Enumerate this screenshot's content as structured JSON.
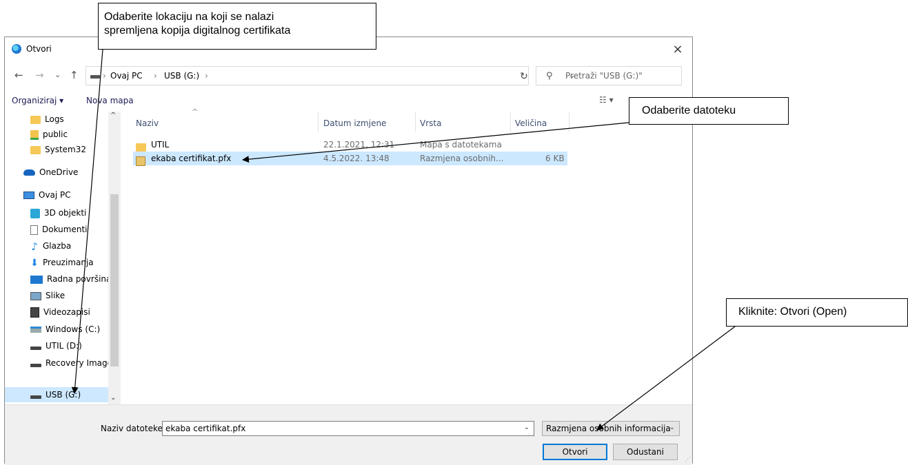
{
  "dialog": {
    "title": "Otvori",
    "close_glyph": "×",
    "nav": {
      "back": "←",
      "forward": "→",
      "recent": "⌄",
      "up": "↑"
    },
    "breadcrumb": [
      "Ovaj PC",
      "USB (G:)"
    ],
    "crumb_sep": "›",
    "refresh_glyph": "↻",
    "search_placeholder": "Pretraži \"USB (G:)\"",
    "toolbar": {
      "organize": "Organiziraj ▾",
      "new_folder": "Nova mapa"
    },
    "nav_items": [
      {
        "label": "Logs",
        "icon": "folder-icon"
      },
      {
        "label": "public",
        "icon": "public-folder-icon"
      },
      {
        "label": "System32",
        "icon": "folder-icon"
      },
      {
        "label": "OneDrive",
        "icon": "onedrive-icon"
      },
      {
        "label": "Ovaj PC",
        "icon": "pc-icon"
      },
      {
        "label": "3D objekti",
        "icon": "3d-objects-icon"
      },
      {
        "label": "Dokumenti",
        "icon": "documents-icon"
      },
      {
        "label": "Glazba",
        "icon": "music-icon"
      },
      {
        "label": "Preuzimanja",
        "icon": "downloads-icon"
      },
      {
        "label": "Radna površina",
        "icon": "desktop-icon"
      },
      {
        "label": "Slike",
        "icon": "pictures-icon"
      },
      {
        "label": "Videozapisi",
        "icon": "videos-icon"
      },
      {
        "label": "Windows (C:)",
        "icon": "windows-drive-icon"
      },
      {
        "label": "UTIL (D:)",
        "icon": "drive-icon"
      },
      {
        "label": "Recovery Image",
        "icon": "drive-icon"
      },
      {
        "label": "USB (G:)",
        "icon": "drive-icon"
      }
    ],
    "columns": {
      "name": "Naziv",
      "date": "Datum izmjene",
      "type": "Vrsta",
      "size": "Veličina"
    },
    "files": [
      {
        "name": "UTIL",
        "date": "22.1.2021. 12:31",
        "type": "Mapa s datotekama",
        "size": ""
      },
      {
        "name": "ekaba certifikat.pfx",
        "date": "4.5.2022. 13:48",
        "type": "Razmjena osobnih...",
        "size": "6 KB"
      }
    ],
    "filename_label": "Naziv datoteke:",
    "filename_value": "ekaba certifikat.pfx",
    "filetype_value": "Razmjena osobnih informacija",
    "open_button": "Otvori",
    "cancel_button": "Odustani"
  },
  "callouts": {
    "location": [
      "Odaberite lokaciju na koji se nalazi",
      "spremljena kopija digitalnog certifikata"
    ],
    "file": "Odaberite datoteku",
    "open": "Kliknite: Otvori (Open)"
  },
  "colors": {
    "selection": "#cce8ff",
    "accent": "#0078d7"
  }
}
